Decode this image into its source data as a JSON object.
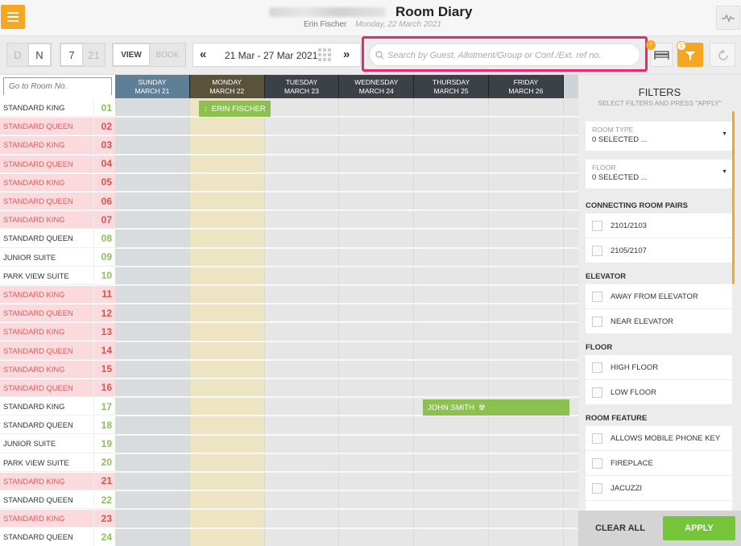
{
  "header": {
    "title": "Room Diary",
    "user": "Erin Fischer",
    "date": "Monday, 22 March 2021"
  },
  "toolbar": {
    "day_letter": "D",
    "night_letter": "N",
    "nights_active": "7",
    "nights_inactive": "21",
    "view_label": "VIEW",
    "book_label": "BOOK",
    "prev": "«",
    "next": "»",
    "date_range": "21 Mar - 27 Mar 2021",
    "search_placeholder": "Search by Guest, Allotment/Group or Conf./Ext. ref no.",
    "bed_badge": "7",
    "filter_badge": "0"
  },
  "goto_placeholder": "Go to Room No.",
  "days": [
    {
      "dow": "SUNDAY",
      "date": "MARCH 21",
      "color": "#5e7f96"
    },
    {
      "dow": "MONDAY",
      "date": "MARCH 22",
      "color": "#5a533c"
    },
    {
      "dow": "TUESDAY",
      "date": "MARCH 23",
      "color": "#3b4147"
    },
    {
      "dow": "WEDNESDAY",
      "date": "MARCH 24",
      "color": "#3b4147"
    },
    {
      "dow": "THURSDAY",
      "date": "MARCH 25",
      "color": "#3b4147"
    },
    {
      "dow": "FRIDAY",
      "date": "MARCH 26",
      "color": "#3b4147"
    }
  ],
  "rooms": [
    {
      "type": "STANDARD KING",
      "no": "01",
      "dirty": false
    },
    {
      "type": "STANDARD QUEEN",
      "no": "02",
      "dirty": true
    },
    {
      "type": "STANDARD KING",
      "no": "03",
      "dirty": true
    },
    {
      "type": "STANDARD QUEEN",
      "no": "04",
      "dirty": true
    },
    {
      "type": "STANDARD KING",
      "no": "05",
      "dirty": true
    },
    {
      "type": "STANDARD QUEEN",
      "no": "06",
      "dirty": true
    },
    {
      "type": "STANDARD KING",
      "no": "07",
      "dirty": true
    },
    {
      "type": "STANDARD QUEEN",
      "no": "08",
      "dirty": false
    },
    {
      "type": "JUNIOR SUITE",
      "no": "09",
      "dirty": false
    },
    {
      "type": "PARK VIEW SUITE",
      "no": "10",
      "dirty": false
    },
    {
      "type": "STANDARD KING",
      "no": "11",
      "dirty": true
    },
    {
      "type": "STANDARD QUEEN",
      "no": "12",
      "dirty": true
    },
    {
      "type": "STANDARD KING",
      "no": "13",
      "dirty": true
    },
    {
      "type": "STANDARD QUEEN",
      "no": "14",
      "dirty": true
    },
    {
      "type": "STANDARD KING",
      "no": "15",
      "dirty": true
    },
    {
      "type": "STANDARD QUEEN",
      "no": "16",
      "dirty": true
    },
    {
      "type": "STANDARD KING",
      "no": "17",
      "dirty": false
    },
    {
      "type": "STANDARD QUEEN",
      "no": "18",
      "dirty": false
    },
    {
      "type": "JUNIOR SUITE",
      "no": "19",
      "dirty": false
    },
    {
      "type": "PARK VIEW SUITE",
      "no": "20",
      "dirty": false
    },
    {
      "type": "STANDARD KING",
      "no": "21",
      "dirty": true
    },
    {
      "type": "STANDARD QUEEN",
      "no": "22",
      "dirty": false
    },
    {
      "type": "STANDARD KING",
      "no": "23",
      "dirty": true
    },
    {
      "type": "STANDARD QUEEN",
      "no": "24",
      "dirty": false
    }
  ],
  "bookings": [
    {
      "guest": "ERIN FISCHER",
      "icon": "arrow-down-icon"
    },
    {
      "guest": "JOHN SMITH",
      "icon": "radiation-icon"
    }
  ],
  "filters": {
    "title": "FILTERS",
    "subtitle": "SELECT FILTERS AND PRESS \"APPLY\"",
    "room_type_label": "ROOM TYPE",
    "room_type_value": "0 SELECTED ...",
    "floor_dd_label": "FLOOR",
    "floor_dd_value": "0 SELECTED ...",
    "connecting_title": "CONNECTING ROOM PAIRS",
    "connecting": [
      "2101/2103",
      "2105/2107"
    ],
    "elevator_title": "ELEVATOR",
    "elevator": [
      "AWAY FROM ELEVATOR",
      "NEAR ELEVATOR"
    ],
    "floor_title": "FLOOR",
    "floor": [
      "HIGH FLOOR",
      "LOW FLOOR"
    ],
    "feature_title": "ROOM FEATURE",
    "feature": [
      "ALLOWS MOBILE PHONE KEY",
      "FIREPLACE",
      "JACUZZI"
    ],
    "clear_label": "CLEAR ALL",
    "apply_label": "APPLY"
  },
  "colors": {
    "accent": "#f5a623",
    "green": "#8cc152",
    "dirty_bg": "#fadadd",
    "highlight": "#e8286f"
  }
}
